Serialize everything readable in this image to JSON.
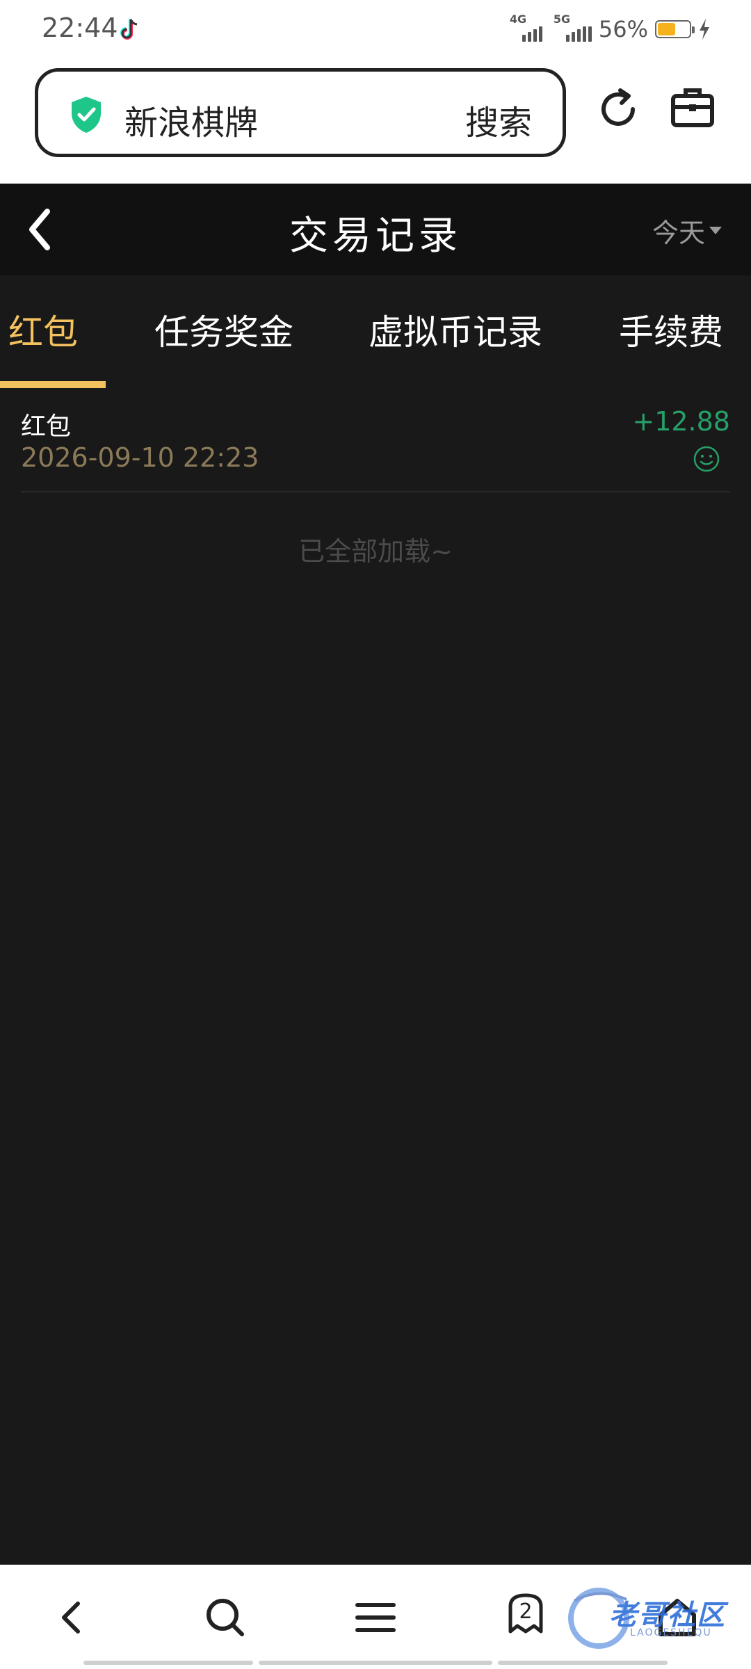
{
  "status_bar": {
    "time": "22:44",
    "net1": "4G",
    "net2": "5G",
    "battery": "56%"
  },
  "browser": {
    "address_text": "新浪棋牌",
    "search_label": "搜索",
    "shield_color": "#1fc68a"
  },
  "header": {
    "title": "交易记录",
    "filter": "今天"
  },
  "tabs": [
    {
      "label": "红包",
      "active": true
    },
    {
      "label": "任务奖金",
      "active": false
    },
    {
      "label": "虚拟币记录",
      "active": false
    },
    {
      "label": "手续费",
      "active": false
    }
  ],
  "records": [
    {
      "title": "红包",
      "time": "2026-09-10 22:23",
      "amount": "+12.88"
    }
  ],
  "end_note": "已全部加载~",
  "bottom_nav": {
    "tab_count": "2",
    "watermark": "老哥社区",
    "watermark_sub": "LAOGESHEQU"
  },
  "colors": {
    "accent": "#f3c15d",
    "amount_positive": "#26a068",
    "background": "#191919"
  }
}
